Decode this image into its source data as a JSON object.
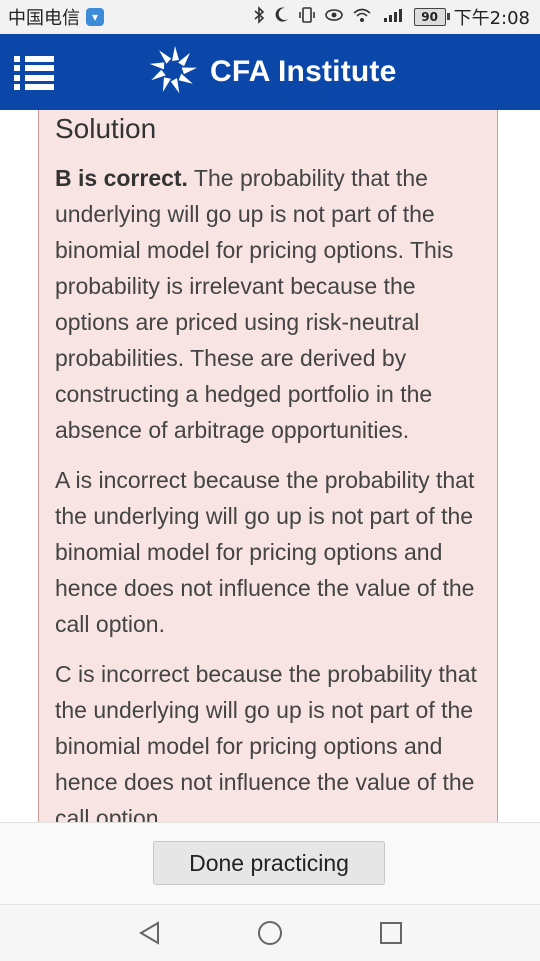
{
  "status_bar": {
    "carrier": "中国电信",
    "battery": "90",
    "time": "下午2:08"
  },
  "header": {
    "brand": "CFA Institute",
    "icons": [
      "menu-icon",
      "cfa-logo-icon"
    ]
  },
  "solution": {
    "title": "Solution",
    "paragraphs": [
      {
        "bold": "B is correct.",
        "text": " The probability that the underlying will go up is not part of the binomial model for pricing options. This probability is irrelevant because the options are priced using risk-neutral probabilities. These are derived by constructing a hedged portfolio in the absence of arbitrage opportunities."
      },
      {
        "text": "A is incorrect because the probability that the underlying will go up is not part of the binomial model for pricing options and hence does not influence the value of the call option."
      },
      {
        "text": "C is incorrect because the probability that the underlying will go up is not part of the binomial model for pricing options and hence does not influence the value of the call option."
      }
    ]
  },
  "footer": {
    "done_label": "Done practicing"
  },
  "nav_bar": {
    "icons": [
      "back-icon",
      "home-icon",
      "recents-icon"
    ]
  },
  "colors": {
    "header_bg": "#0a47a8",
    "solution_bg": "#f9e4e4",
    "solution_border": "#d79a9a"
  }
}
